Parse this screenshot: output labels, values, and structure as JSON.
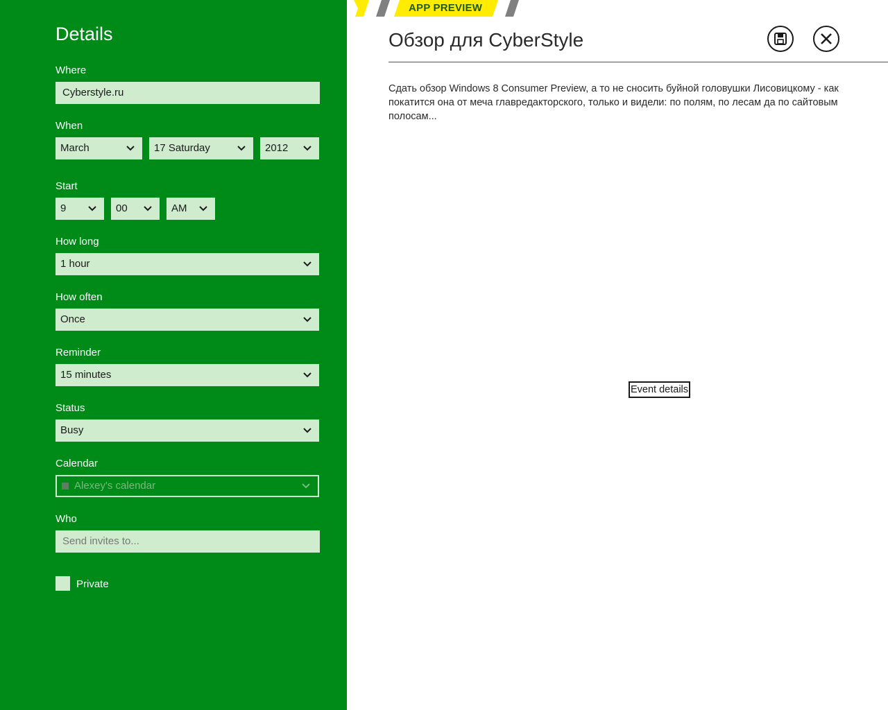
{
  "sidebar": {
    "title": "Details",
    "where": {
      "label": "Where",
      "value": "Cyberstyle.ru"
    },
    "when": {
      "label": "When",
      "month": "March",
      "day": "17 Saturday",
      "year": "2012"
    },
    "start": {
      "label": "Start",
      "hour": "9",
      "minute": "00",
      "ampm": "AM"
    },
    "how_long": {
      "label": "How long",
      "value": "1 hour"
    },
    "how_often": {
      "label": "How often",
      "value": "Once"
    },
    "reminder": {
      "label": "Reminder",
      "value": "15 minutes"
    },
    "status": {
      "label": "Status",
      "value": "Busy"
    },
    "calendar": {
      "label": "Calendar",
      "value": "Alexey's calendar"
    },
    "who": {
      "label": "Who",
      "placeholder": "Send invites to..."
    },
    "private": {
      "label": "Private",
      "checked": false
    }
  },
  "banner": {
    "text": "APP PREVIEW",
    "color": "#ffec00"
  },
  "event": {
    "title": "Обзор для CyberStyle",
    "description": "Сдать обзор Windows 8 Consumer Preview, а то не сносить буйной головушки Лисовицкому - как покатится она от меча главредакторского, только и видели: по полям, по лесам да по сайтовым полосам...",
    "details_label": "Event details"
  },
  "actions": {
    "save_icon": "save-icon",
    "close_icon": "close-icon"
  },
  "colors": {
    "accent": "#008a17",
    "field_bg": "#cfeccf"
  }
}
